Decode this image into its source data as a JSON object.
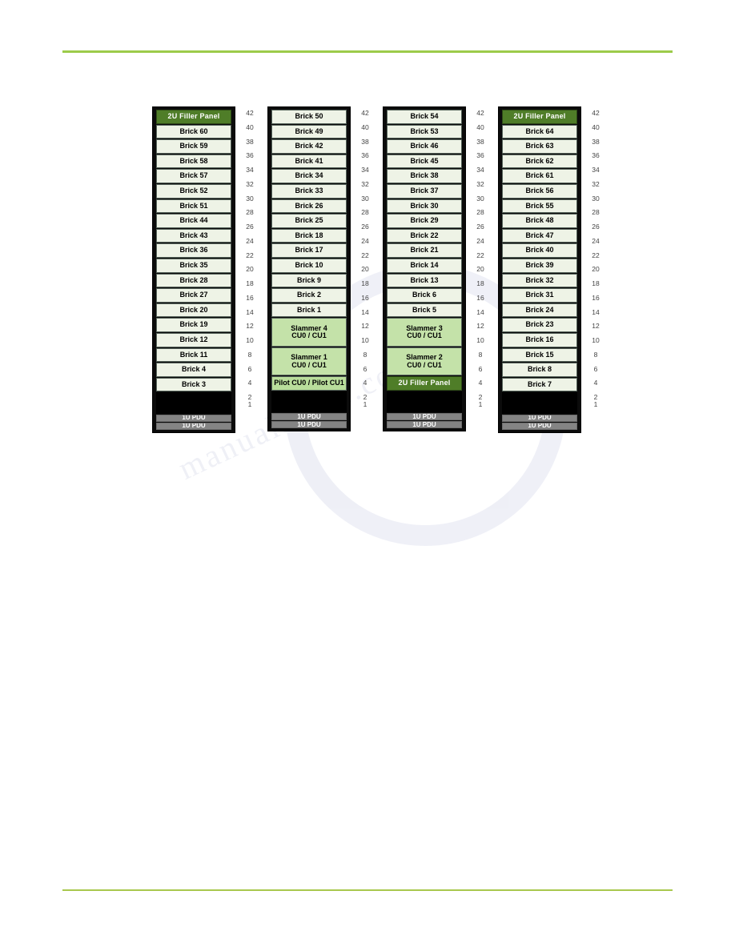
{
  "page": {
    "background_color": "#ffffff",
    "rule_color": "#9ccb4a",
    "watermark_text": "manualshive.com"
  },
  "colors": {
    "brick_fill": "#eef3e6",
    "filler_fill": "#4f7d28",
    "slammer_fill": "#c4e2a9",
    "pilot_fill": "#b9dd9b",
    "pdu_fill": "#848484",
    "rack_frame": "#0b0b0b",
    "gap_fill": "#000000"
  },
  "scale": {
    "label": "rack-unit-scale",
    "ticks": [
      "42",
      "40",
      "38",
      "36",
      "34",
      "32",
      "30",
      "28",
      "26",
      "24",
      "22",
      "20",
      "18",
      "16",
      "14",
      "12",
      "10",
      "8",
      "6",
      "4",
      "2",
      "1"
    ]
  },
  "racks": [
    {
      "name": "rack-1",
      "units": [
        {
          "type": "filler",
          "label": "2U Filler Panel",
          "u": 2
        },
        {
          "type": "brick",
          "label": "Brick 60",
          "u": 2
        },
        {
          "type": "brick",
          "label": "Brick 59",
          "u": 2
        },
        {
          "type": "brick",
          "label": "Brick 58",
          "u": 2
        },
        {
          "type": "brick",
          "label": "Brick 57",
          "u": 2
        },
        {
          "type": "brick",
          "label": "Brick 52",
          "u": 2
        },
        {
          "type": "brick",
          "label": "Brick 51",
          "u": 2
        },
        {
          "type": "brick",
          "label": "Brick 44",
          "u": 2
        },
        {
          "type": "brick",
          "label": "Brick 43",
          "u": 2
        },
        {
          "type": "brick",
          "label": "Brick 36",
          "u": 2
        },
        {
          "type": "brick",
          "label": "Brick 35",
          "u": 2
        },
        {
          "type": "brick",
          "label": "Brick 28",
          "u": 2
        },
        {
          "type": "brick",
          "label": "Brick 27",
          "u": 2
        },
        {
          "type": "brick",
          "label": "Brick 20",
          "u": 2
        },
        {
          "type": "brick",
          "label": "Brick 19",
          "u": 2
        },
        {
          "type": "brick",
          "label": "Brick 12",
          "u": 2
        },
        {
          "type": "brick",
          "label": "Brick 11",
          "u": 2
        },
        {
          "type": "brick",
          "label": "Brick 4",
          "u": 2
        },
        {
          "type": "brick",
          "label": "Brick 3",
          "u": 2
        },
        {
          "type": "gap",
          "label": "",
          "u": 3
        },
        {
          "type": "pdu",
          "label": "1U PDU",
          "u": 1
        },
        {
          "type": "pdu",
          "label": "1U PDU",
          "u": 1
        }
      ]
    },
    {
      "name": "rack-2",
      "units": [
        {
          "type": "brick",
          "label": "Brick 50",
          "u": 2
        },
        {
          "type": "brick",
          "label": "Brick 49",
          "u": 2
        },
        {
          "type": "brick",
          "label": "Brick 42",
          "u": 2
        },
        {
          "type": "brick",
          "label": "Brick 41",
          "u": 2
        },
        {
          "type": "brick",
          "label": "Brick 34",
          "u": 2
        },
        {
          "type": "brick",
          "label": "Brick 33",
          "u": 2
        },
        {
          "type": "brick",
          "label": "Brick 26",
          "u": 2
        },
        {
          "type": "brick",
          "label": "Brick 25",
          "u": 2
        },
        {
          "type": "brick",
          "label": "Brick 18",
          "u": 2
        },
        {
          "type": "brick",
          "label": "Brick 17",
          "u": 2
        },
        {
          "type": "brick",
          "label": "Brick 10",
          "u": 2
        },
        {
          "type": "brick",
          "label": "Brick 9",
          "u": 2
        },
        {
          "type": "brick",
          "label": "Brick 2",
          "u": 2
        },
        {
          "type": "brick",
          "label": "Brick 1",
          "u": 2
        },
        {
          "type": "slammer",
          "label": "Slammer 4",
          "sublabel": "CU0 / CU1",
          "u": 4
        },
        {
          "type": "slammer",
          "label": "Slammer 1",
          "sublabel": "CU0 / CU1",
          "u": 4
        },
        {
          "type": "pilot",
          "label": "Pilot CU0 / Pilot CU1",
          "u": 2
        },
        {
          "type": "gap",
          "label": "",
          "u": 3
        },
        {
          "type": "pdu",
          "label": "1U PDU",
          "u": 1
        },
        {
          "type": "pdu",
          "label": "1U PDU",
          "u": 1
        }
      ]
    },
    {
      "name": "rack-3",
      "units": [
        {
          "type": "brick",
          "label": "Brick 54",
          "u": 2
        },
        {
          "type": "brick",
          "label": "Brick 53",
          "u": 2
        },
        {
          "type": "brick",
          "label": "Brick 46",
          "u": 2
        },
        {
          "type": "brick",
          "label": "Brick 45",
          "u": 2
        },
        {
          "type": "brick",
          "label": "Brick 38",
          "u": 2
        },
        {
          "type": "brick",
          "label": "Brick 37",
          "u": 2
        },
        {
          "type": "brick",
          "label": "Brick 30",
          "u": 2
        },
        {
          "type": "brick",
          "label": "Brick 29",
          "u": 2
        },
        {
          "type": "brick",
          "label": "Brick 22",
          "u": 2
        },
        {
          "type": "brick",
          "label": "Brick 21",
          "u": 2
        },
        {
          "type": "brick",
          "label": "Brick 14",
          "u": 2
        },
        {
          "type": "brick",
          "label": "Brick 13",
          "u": 2
        },
        {
          "type": "brick",
          "label": "Brick 6",
          "u": 2
        },
        {
          "type": "brick",
          "label": "Brick 5",
          "u": 2
        },
        {
          "type": "slammer",
          "label": "Slammer 3",
          "sublabel": "CU0 / CU1",
          "u": 4
        },
        {
          "type": "slammer",
          "label": "Slammer 2",
          "sublabel": "CU0 / CU1",
          "u": 4
        },
        {
          "type": "filler",
          "label": "2U Filler Panel",
          "u": 2
        },
        {
          "type": "gap",
          "label": "",
          "u": 3
        },
        {
          "type": "pdu",
          "label": "1U PDU",
          "u": 1
        },
        {
          "type": "pdu",
          "label": "1U PDU",
          "u": 1
        }
      ]
    },
    {
      "name": "rack-4",
      "units": [
        {
          "type": "filler",
          "label": "2U Filler Panel",
          "u": 2
        },
        {
          "type": "brick",
          "label": "Brick 64",
          "u": 2
        },
        {
          "type": "brick",
          "label": "Brick 63",
          "u": 2
        },
        {
          "type": "brick",
          "label": "Brick 62",
          "u": 2
        },
        {
          "type": "brick",
          "label": "Brick 61",
          "u": 2
        },
        {
          "type": "brick",
          "label": "Brick 56",
          "u": 2
        },
        {
          "type": "brick",
          "label": "Brick 55",
          "u": 2
        },
        {
          "type": "brick",
          "label": "Brick 48",
          "u": 2
        },
        {
          "type": "brick",
          "label": "Brick 47",
          "u": 2
        },
        {
          "type": "brick",
          "label": "Brick 40",
          "u": 2
        },
        {
          "type": "brick",
          "label": "Brick 39",
          "u": 2
        },
        {
          "type": "brick",
          "label": "Brick 32",
          "u": 2
        },
        {
          "type": "brick",
          "label": "Brick 31",
          "u": 2
        },
        {
          "type": "brick",
          "label": "Brick 24",
          "u": 2
        },
        {
          "type": "brick",
          "label": "Brick 23",
          "u": 2
        },
        {
          "type": "brick",
          "label": "Brick 16",
          "u": 2
        },
        {
          "type": "brick",
          "label": "Brick 15",
          "u": 2
        },
        {
          "type": "brick",
          "label": "Brick 8",
          "u": 2
        },
        {
          "type": "brick",
          "label": "Brick 7",
          "u": 2
        },
        {
          "type": "gap",
          "label": "",
          "u": 3
        },
        {
          "type": "pdu",
          "label": "1U PDU",
          "u": 1
        },
        {
          "type": "pdu",
          "label": "1U PDU",
          "u": 1
        }
      ]
    }
  ]
}
